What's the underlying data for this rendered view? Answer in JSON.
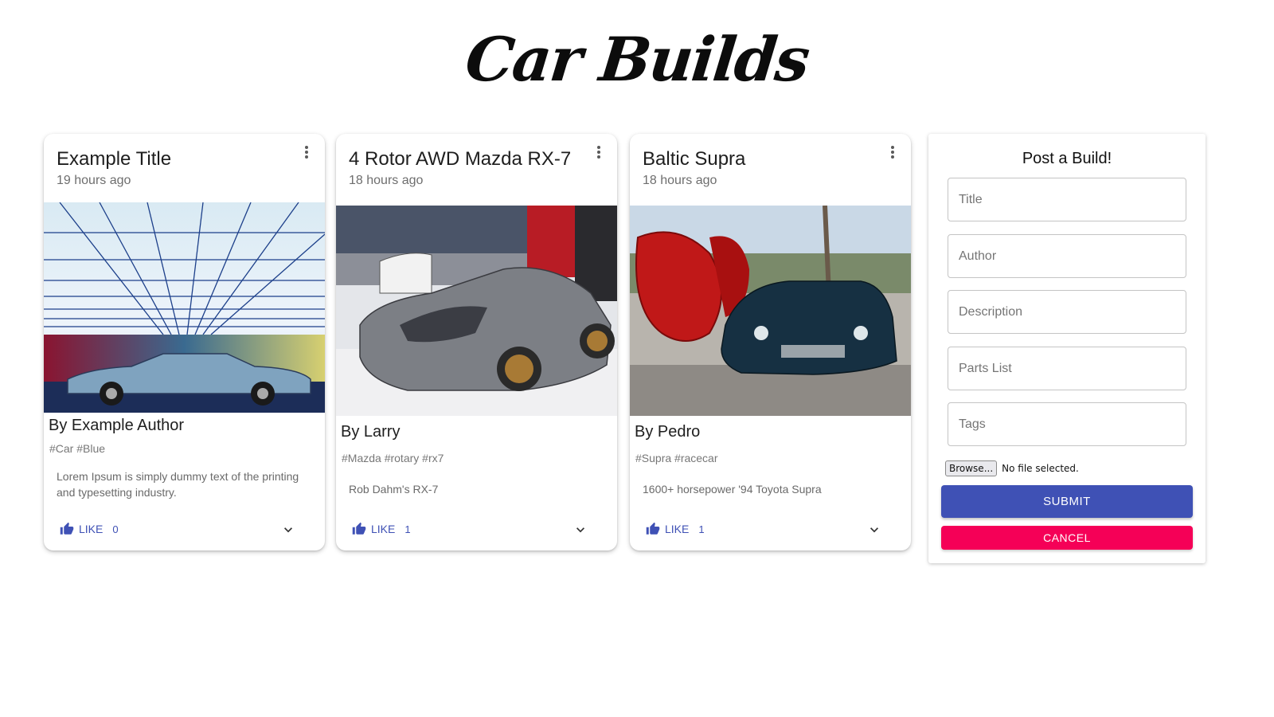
{
  "header": {
    "title": "Car Builds"
  },
  "colors": {
    "primary": "#3f51b5",
    "secondary": "#f50057"
  },
  "cards": [
    {
      "title": "Example Title",
      "time": "19 hours ago",
      "author": "By Example Author",
      "tags": "#Car #Blue",
      "description": "Lorem Ipsum is simply dummy text of the printing and typesetting industry.",
      "like_label": "LIKE",
      "likes": "0",
      "image": "blue vintage convertible in tunnel"
    },
    {
      "title": "4 Rotor AWD Mazda RX-7",
      "time": "18 hours ago",
      "author": "By Larry",
      "tags": "#Mazda #rotary #rx7",
      "description": "Rob Dahm's RX-7",
      "like_label": "LIKE",
      "likes": "1",
      "image": "grey RX-7 at car show"
    },
    {
      "title": "Baltic Supra",
      "time": "18 hours ago",
      "author": "By Pedro",
      "tags": "#Supra #racecar",
      "description": "1600+ horsepower '94 Toyota Supra",
      "like_label": "LIKE",
      "likes": "1",
      "image": "dark green Supra with red parachute"
    }
  ],
  "form": {
    "title": "Post a Build!",
    "placeholders": {
      "title": "Title",
      "author": "Author",
      "description": "Description",
      "parts": "Parts List",
      "tags": "Tags"
    },
    "browse_label": "Browse...",
    "file_status": "No file selected.",
    "submit_label": "SUBMIT",
    "cancel_label": "CANCEL"
  }
}
